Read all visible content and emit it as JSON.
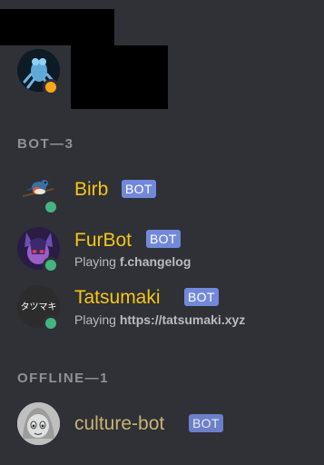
{
  "sections": {
    "bot_header": "BOT—3",
    "offline_header": "OFFLINE—1"
  },
  "members": [
    {
      "name": "Birb",
      "name_color": "#f5c518",
      "tag": "BOT",
      "status": "online",
      "activity_prefix": "",
      "activity_detail": ""
    },
    {
      "name": "FurBot",
      "name_color": "#f5c518",
      "tag": "BOT",
      "status": "online",
      "activity_prefix": "Playing",
      "activity_detail": "f.changelog"
    },
    {
      "name": "Tatsumaki",
      "name_color": "#f5c518",
      "tag": "BOT",
      "status": "online",
      "activity_prefix": "Playing",
      "activity_detail": "https://tatsumaki.xyz",
      "avatar_text": "タツマキ"
    },
    {
      "name": "culture-bot",
      "name_color": "#d8c07a",
      "tag": "BOT",
      "status": "offline",
      "activity_prefix": "",
      "activity_detail": ""
    }
  ],
  "top_user": {
    "status": "idle"
  },
  "colors": {
    "background": "#2f3136",
    "bot_tag": "#7289da",
    "online": "#43b581",
    "idle": "#faa61a"
  }
}
